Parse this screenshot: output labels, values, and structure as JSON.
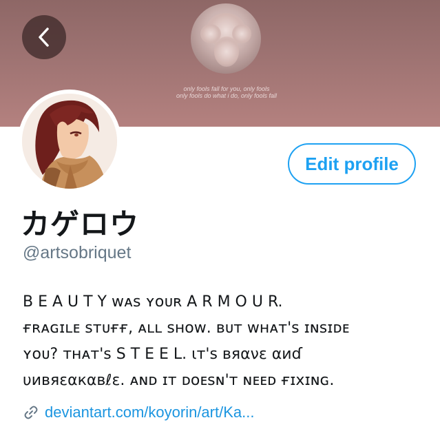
{
  "header": {
    "quote_line1": "only fools fall for you, only fools",
    "quote_line2": "only fools do what i do, only fools fall"
  },
  "profile": {
    "display_name": "カゲロウ",
    "handle": "@artsobriquet",
    "edit_label": "Edit profile",
    "bio_lines": [
      "B E A U T Y ᴡᴀs ʏᴏᴜʀ A R M O U R.",
      "ғʀᴀɢɪʟᴇ sᴛᴜғғ, ᴀʟʟ sʜᴏᴡ. ʙᴜᴛ ᴡʜᴀᴛ'ѕ ɪɴsɪᴅᴇ",
      "ʏᴏᴜ? ᴛʜᴀᴛ's S T E E L. ιт's вяανε αиɗ",
      "υивяεαкαвℓε. ᴀɴᴅ ɪᴛ ᴅᴏᴇsɴ'ᴛ ɴᴇᴇᴅ ғɪxɪɴɢ."
    ],
    "link": "deviantart.com/koyorin/art/Ka..."
  },
  "icons": {
    "back": "chevron-left-icon",
    "link": "link-icon"
  },
  "colors": {
    "accent": "#1da1f2",
    "header_top": "#8e6766",
    "header_bottom": "#b4817f",
    "handle_gray": "#657786"
  }
}
